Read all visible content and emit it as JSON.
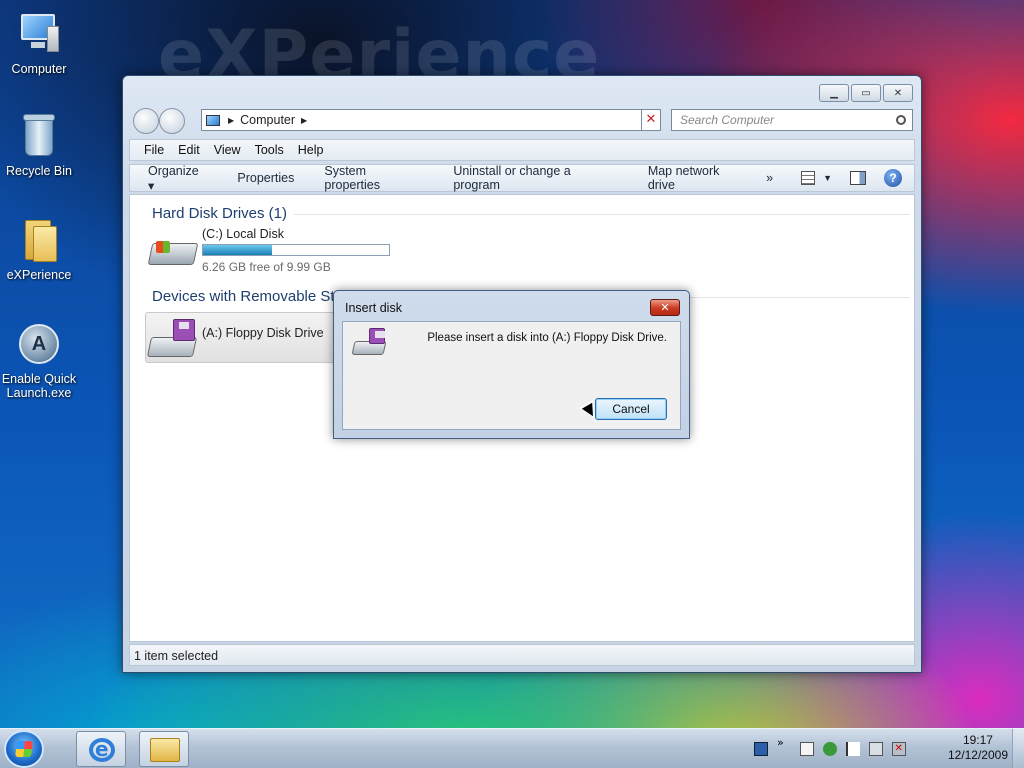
{
  "desktop": {
    "watermark": "eXPerience",
    "icons": [
      {
        "label": "Computer"
      },
      {
        "label": "Recycle Bin"
      },
      {
        "label": "eXPerience"
      },
      {
        "label": "Enable Quick Launch.exe"
      }
    ]
  },
  "explorer": {
    "address": {
      "location": "Computer"
    },
    "search": {
      "placeholder": "Search Computer"
    },
    "menu": [
      "File",
      "Edit",
      "View",
      "Tools",
      "Help"
    ],
    "commands": {
      "organize": "Organize ▾",
      "properties": "Properties",
      "system_properties": "System properties",
      "uninstall": "Uninstall or change a program",
      "map_drive": "Map network drive",
      "more": "»"
    },
    "groups": {
      "hard_disks": {
        "title": "Hard Disk Drives (1)",
        "drive": {
          "name": "(C:) Local Disk",
          "free_text": "6.26 GB free of 9.99 GB",
          "used_fraction": 0.373
        }
      },
      "removable": {
        "title": "Devices with Removable Storage",
        "drive": {
          "name": "(A:) Floppy Disk Drive"
        }
      }
    },
    "status": "1 item selected"
  },
  "dialog": {
    "title": "Insert disk",
    "message": "Please insert a disk into (A:) Floppy Disk Drive.",
    "cancel": "Cancel",
    "close_glyph": "✕"
  },
  "taskbar": {
    "clock": {
      "time": "19:17",
      "date": "12/12/2009"
    },
    "tray_chevron": "»"
  },
  "colors": {
    "group_title": "#1e3f6e",
    "capacity_fill": "#1a7fb7",
    "close_red": "#c83a20"
  }
}
